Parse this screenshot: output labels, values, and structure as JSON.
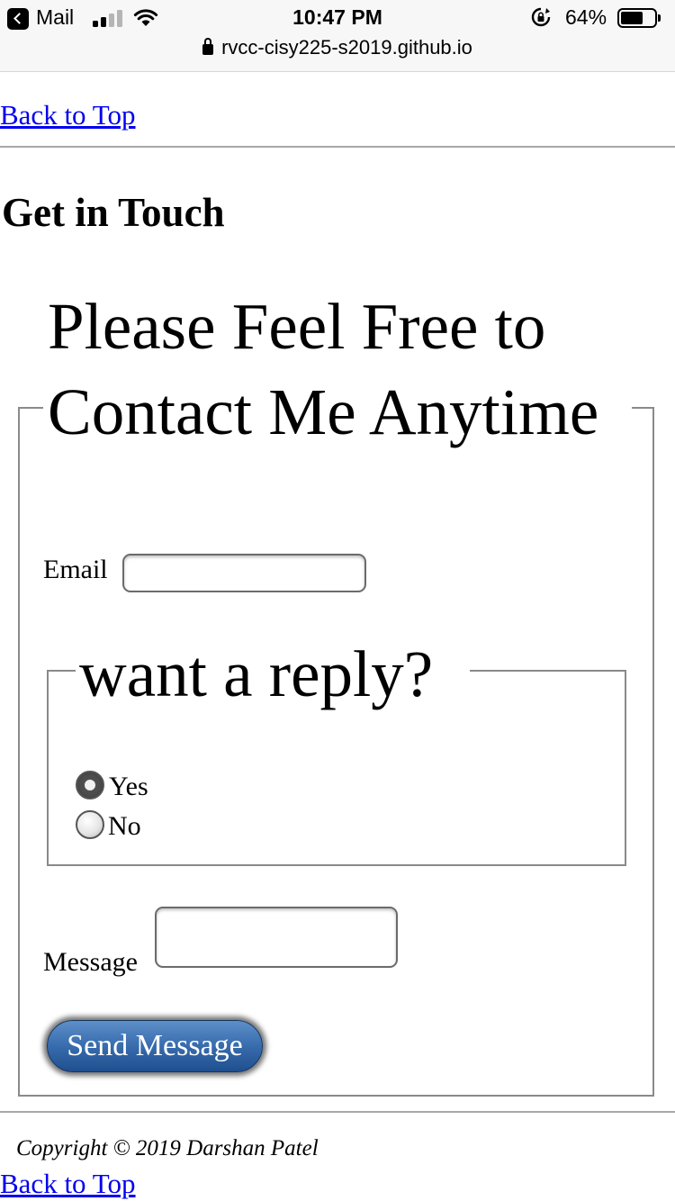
{
  "status_bar": {
    "back_app": "Mail",
    "time": "10:47 PM",
    "battery_percent": "64%",
    "battery_level": 0.64,
    "signal_bars": 2,
    "url": "rvcc-cisy225-s2019.github.io"
  },
  "page": {
    "back_to_top_top": "Back to Top",
    "heading": "Get in Touch",
    "form": {
      "legend": "Please Feel Free to Contact Me Anytime",
      "email_label": "Email",
      "email_value": "",
      "reply_legend": "want a reply?",
      "reply_options": [
        {
          "label": "Yes",
          "checked": true
        },
        {
          "label": "No",
          "checked": false
        }
      ],
      "message_label": "Message",
      "message_value": "",
      "submit_label": "Send Message"
    },
    "copyright": "Copyright © 2019 Darshan Patel",
    "back_to_top_bottom": "Back to Top"
  },
  "colors": {
    "link": "#0000ee",
    "button_blue": "#3b6fb0",
    "border_gray": "#8a8a8a"
  }
}
